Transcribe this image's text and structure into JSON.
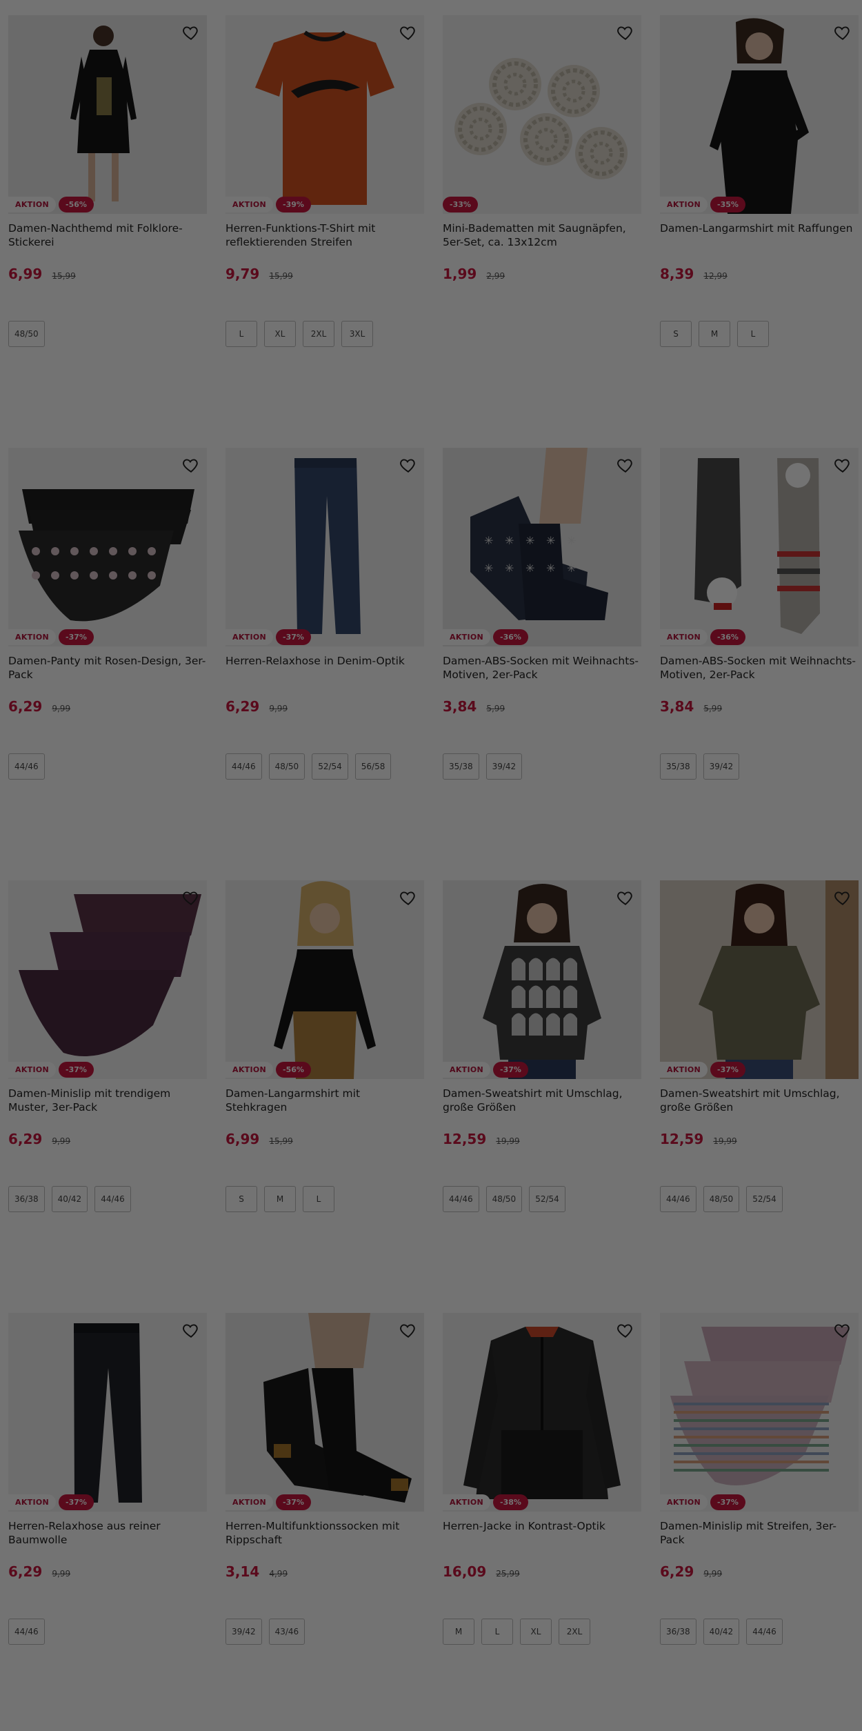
{
  "products": [
    {
      "title": "Damen-Nachthemd mit Folklore-Stickerei",
      "badge": "AKTION",
      "discount": "-56%",
      "price": "6,99",
      "old_price": "15,99",
      "sizes": [
        "48/50"
      ],
      "img": "nightdress"
    },
    {
      "title": "Herren-Funktions-T-Shirt mit reflektierenden Streifen",
      "badge": "AKTION",
      "discount": "-39%",
      "price": "9,79",
      "old_price": "15,99",
      "sizes": [
        "L",
        "XL",
        "2XL",
        "3XL"
      ],
      "img": "tshirt"
    },
    {
      "title": "Mini-Badematten mit Saugnäpfen, 5er-Set, ca. 13x12cm",
      "badge": "",
      "discount": "-33%",
      "price": "1,99",
      "old_price": "2,99",
      "sizes": [],
      "img": "mats"
    },
    {
      "title": "Damen-Langarmshirt mit Raffungen",
      "badge": "AKTION",
      "discount": "-35%",
      "price": "8,39",
      "old_price": "12,99",
      "sizes": [
        "S",
        "M",
        "L"
      ],
      "img": "longsleeve"
    },
    {
      "title": "Damen-Panty mit Rosen-Design, 3er-Pack",
      "badge": "AKTION",
      "discount": "-37%",
      "price": "6,29",
      "old_price": "9,99",
      "sizes": [
        "44/46"
      ],
      "img": "panty"
    },
    {
      "title": "Herren-Relaxhose in Denim-Optik",
      "badge": "AKTION",
      "discount": "-37%",
      "price": "6,29",
      "old_price": "9,99",
      "sizes": [
        "44/46",
        "48/50",
        "52/54",
        "56/58"
      ],
      "img": "jeans"
    },
    {
      "title": "Damen-ABS-Socken mit Weihnachts-Motiven, 2er-Pack",
      "badge": "AKTION",
      "discount": "-36%",
      "price": "3,84",
      "old_price": "5,99",
      "sizes": [
        "35/38",
        "39/42"
      ],
      "img": "socks_feet"
    },
    {
      "title": "Damen-ABS-Socken mit Weihnachts-Motiven, 2er-Pack",
      "badge": "AKTION",
      "discount": "-36%",
      "price": "3,84",
      "old_price": "5,99",
      "sizes": [
        "35/38",
        "39/42"
      ],
      "img": "socks_flat"
    },
    {
      "title": "Damen-Minislip mit trendigem Muster, 3er-Pack",
      "badge": "AKTION",
      "discount": "-37%",
      "price": "6,29",
      "old_price": "9,99",
      "sizes": [
        "36/38",
        "40/42",
        "44/46"
      ],
      "img": "slips_purple"
    },
    {
      "title": "Damen-Langarmshirt mit Stehkragen",
      "badge": "AKTION",
      "discount": "-56%",
      "price": "6,99",
      "old_price": "15,99",
      "sizes": [
        "S",
        "M",
        "L"
      ],
      "img": "blonde"
    },
    {
      "title": "Damen-Sweatshirt mit Umschlag, große Größen",
      "badge": "AKTION",
      "discount": "-37%",
      "price": "12,59",
      "old_price": "19,99",
      "sizes": [
        "44/46",
        "48/50",
        "52/54"
      ],
      "img": "sweat_pattern"
    },
    {
      "title": "Damen-Sweatshirt mit Umschlag, große Größen",
      "badge": "AKTION",
      "discount": "-37%",
      "price": "12,59",
      "old_price": "19,99",
      "sizes": [
        "44/46",
        "48/50",
        "52/54"
      ],
      "img": "sweat_olive"
    },
    {
      "title": "Herren-Relaxhose aus reiner Baumwolle",
      "badge": "AKTION",
      "discount": "-37%",
      "price": "6,29",
      "old_price": "9,99",
      "sizes": [
        "44/46"
      ],
      "img": "pants_dark"
    },
    {
      "title": "Herren-Multifunktionssocken mit Rippschaft",
      "badge": "AKTION",
      "discount": "-37%",
      "price": "3,14",
      "old_price": "4,99",
      "sizes": [
        "39/42",
        "43/46"
      ],
      "img": "socks_black"
    },
    {
      "title": "Herren-Jacke in Kontrast-Optik",
      "badge": "AKTION",
      "discount": "-38%",
      "price": "16,09",
      "old_price": "25,99",
      "sizes": [
        "M",
        "L",
        "XL",
        "2XL"
      ],
      "img": "jacket"
    },
    {
      "title": "Damen-Minislip mit Streifen, 3er-Pack",
      "badge": "AKTION",
      "discount": "-37%",
      "price": "6,29",
      "old_price": "9,99",
      "sizes": [
        "36/38",
        "40/42",
        "44/46"
      ],
      "img": "slips_striped"
    }
  ],
  "colors": {
    "accent": "#c8173f",
    "overlay": "rgba(0,0,0,0.55)"
  }
}
